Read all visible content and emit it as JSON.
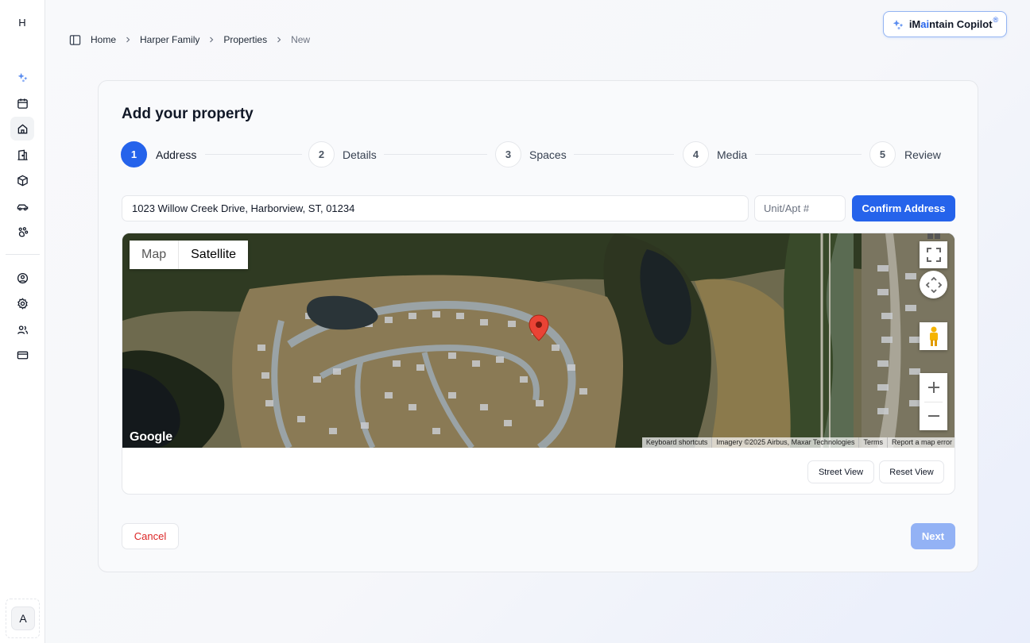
{
  "sidebar": {
    "logo_initial": "H",
    "items": [
      {
        "icon": "sparkles-icon"
      },
      {
        "icon": "calendar-icon"
      },
      {
        "icon": "home-icon"
      },
      {
        "icon": "building-icon"
      },
      {
        "icon": "package-icon"
      },
      {
        "icon": "car-icon"
      },
      {
        "icon": "pets-icon"
      },
      {
        "icon": "user-circle-icon"
      },
      {
        "icon": "settings-icon"
      },
      {
        "icon": "users-icon"
      },
      {
        "icon": "credit-card-icon"
      }
    ],
    "active_item": "home-icon",
    "avatar_initial": "A"
  },
  "breadcrumb": {
    "items": [
      "Home",
      "Harper Family",
      "Properties",
      "New"
    ]
  },
  "copilot": {
    "label_prefix": "iM",
    "label_accent": "ai",
    "label_suffix": "ntain Copilot",
    "reg_mark": "®",
    "accent_color": "#2563eb"
  },
  "card": {
    "title": "Add your property",
    "steps": [
      {
        "number": "1",
        "label": "Address"
      },
      {
        "number": "2",
        "label": "Details"
      },
      {
        "number": "3",
        "label": "Spaces"
      },
      {
        "number": "4",
        "label": "Media"
      },
      {
        "number": "5",
        "label": "Review"
      }
    ],
    "active_step": 1,
    "address": {
      "value": "1023 Willow Creek Drive, Harborview, ST, 01234",
      "unit_placeholder": "Unit/Apt #",
      "confirm_label": "Confirm Address"
    },
    "map": {
      "type_options": [
        "Map",
        "Satellite"
      ],
      "selected_type": "Satellite",
      "google_logo": "Google",
      "attribution": [
        "Keyboard shortcuts",
        "Imagery ©2025 Airbus, Maxar Technologies",
        "Terms",
        "Report a map error"
      ],
      "zoom_in": "+",
      "zoom_out": "−",
      "street_view_label": "Street View",
      "reset_view_label": "Reset View"
    },
    "cancel_label": "Cancel",
    "next_label": "Next"
  },
  "colors": {
    "primary": "#2563eb",
    "danger": "#dc2626",
    "next_disabled": "#93b2f5"
  }
}
